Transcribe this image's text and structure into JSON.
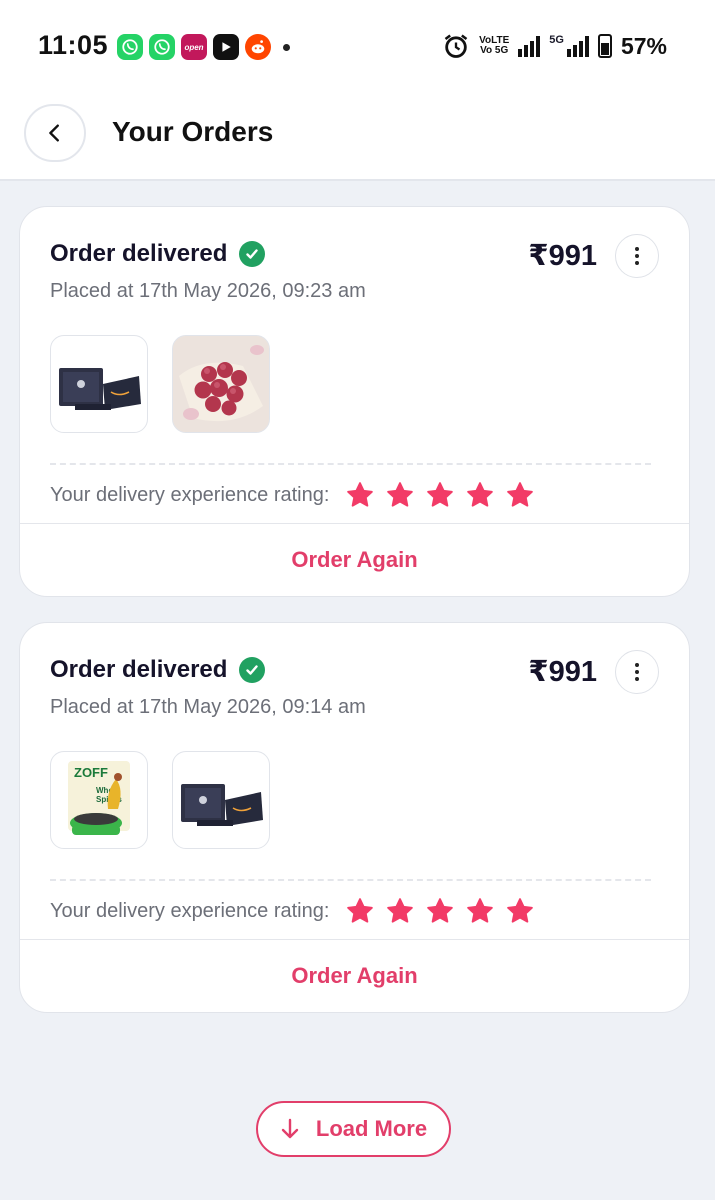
{
  "status_bar": {
    "time": "11:05",
    "notif_apps": [
      {
        "name": "whatsapp-icon",
        "glyph": "✆"
      },
      {
        "name": "whatsapp-business-icon",
        "glyph": "✆"
      },
      {
        "name": "open-app-icon",
        "glyph": "open"
      },
      {
        "name": "youtube-icon",
        "glyph": "▶"
      },
      {
        "name": "reddit-icon",
        "glyph": "●"
      }
    ],
    "volte_line1": "VoLTE",
    "volte_line2": "Vo 5G",
    "network_5g": "5G",
    "battery": "57%"
  },
  "header": {
    "title": "Your Orders",
    "back_icon": "chevron-left-icon"
  },
  "colors": {
    "accent": "#e23e6a",
    "success": "#21a161",
    "star": "#f23b67"
  },
  "orders": [
    {
      "status": "Order delivered",
      "placed": "Placed at 17th May 2026, 09:23 am",
      "price": "₹991",
      "items": [
        "amazon-gift-card-box",
        "red-onions"
      ],
      "rating_label": "Your delivery experience rating:",
      "rating": 5,
      "action": "Order Again"
    },
    {
      "status": "Order delivered",
      "placed": "Placed at 17th May 2026, 09:14 am",
      "price": "₹991",
      "items": [
        "zoff-whole-spices-pack",
        "amazon-gift-card-box"
      ],
      "rating_label": "Your delivery experience rating:",
      "rating": 5,
      "action": "Order Again"
    }
  ],
  "zoff_pack": {
    "brand": "ZOFF",
    "line1": "Whole",
    "line2": "Spices"
  },
  "load_more": "Load More"
}
